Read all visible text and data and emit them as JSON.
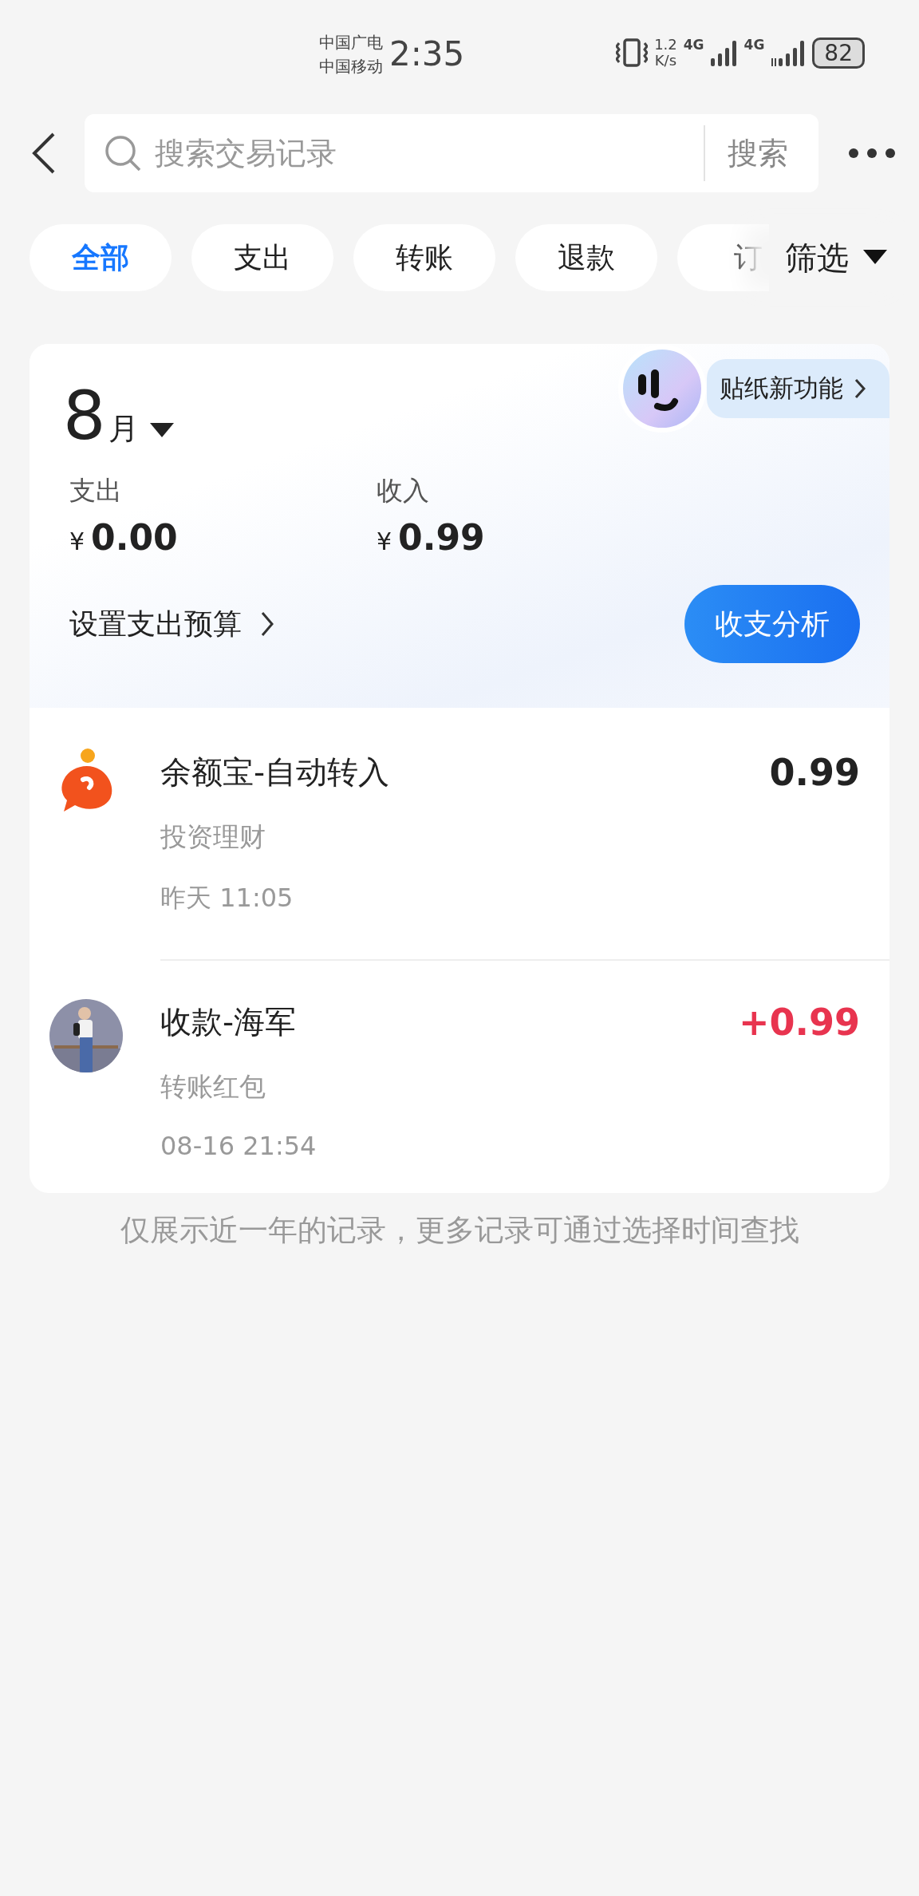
{
  "status_bar": {
    "carriers": [
      "中国广电",
      "中国移动"
    ],
    "time": "2:35",
    "speed": [
      "1.2",
      "K/s"
    ],
    "network_1": "4G",
    "network_2": "4G",
    "battery": "82"
  },
  "header": {
    "search": {
      "placeholder": "搜索交易记录"
    },
    "search_button": "搜索"
  },
  "tabs": [
    {
      "label": "全部",
      "selected": true
    },
    {
      "label": "支出",
      "selected": false
    },
    {
      "label": "转账",
      "selected": false
    },
    {
      "label": "退款",
      "selected": false
    },
    {
      "label": "订",
      "selected": false
    }
  ],
  "filter": "筛选",
  "summary": {
    "month_number": "8",
    "month_unit": "月",
    "sticker_banner": "贴纸新功能",
    "expense_label": "支出",
    "expense_currency": "¥",
    "expense": "0.00",
    "income_label": "收入",
    "income_currency": "¥",
    "income": "0.99",
    "budget_link": "设置支出预算",
    "analysis_button": "收支分析"
  },
  "transactions": [
    {
      "kind": "fund",
      "title": "余额宝-自动转入",
      "category": "投资理财",
      "time": "昨天 11:05",
      "amount": "0.99",
      "income": false
    },
    {
      "kind": "picture",
      "title": "收款-海军",
      "category": "转账红包",
      "time": "08-16 21:54",
      "amount": "+0.99",
      "income": true
    }
  ],
  "footer_note": "仅展示近一年的记录，更多记录可通过选择时间查找"
}
